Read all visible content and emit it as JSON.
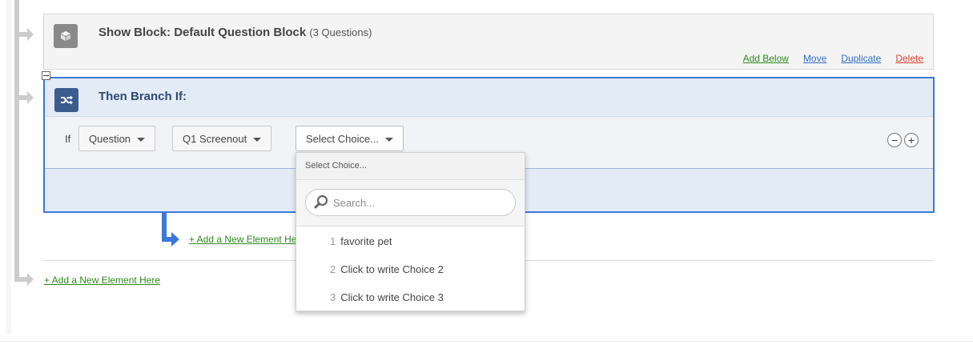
{
  "show_block": {
    "prefix": "Show Block:",
    "name": "Default Question Block",
    "count": "(3 Questions)",
    "actions": {
      "add_below": "Add Below",
      "move": "Move",
      "duplicate": "Duplicate",
      "delete": "Delete"
    }
  },
  "branch_block": {
    "title": "Then Branch If:",
    "condition": {
      "if_label": "If",
      "type": "Question",
      "question": "Q1 Screenout",
      "choice": "Select Choice...",
      "remove_symbol": "−",
      "add_symbol": "+"
    }
  },
  "choice_dropdown": {
    "header": "Select Choice...",
    "search_placeholder": "Search...",
    "options": [
      {
        "num": "1",
        "label": "favorite pet"
      },
      {
        "num": "2",
        "label": "Click to write Choice 2"
      },
      {
        "num": "3",
        "label": "Click to write Choice 3"
      }
    ]
  },
  "add_element_inner": "+ Add a New Element Here",
  "add_element_outer": "+ Add a New Element Here",
  "colors": {
    "accent_blue": "#3c79d8",
    "branch_icon_bg": "#3b5d8e",
    "link_green": "#2c8a1b",
    "link_blue": "#2f6fc4",
    "link_red": "#d9412c"
  }
}
